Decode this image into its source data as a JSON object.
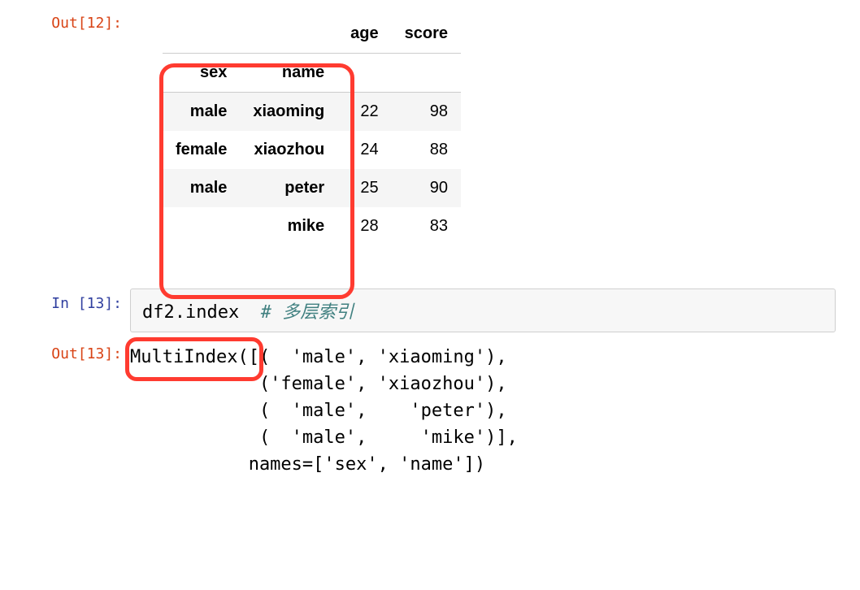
{
  "cells": {
    "out12": {
      "prompt": "Out[12]:",
      "columns": [
        "age",
        "score"
      ],
      "index_names": [
        "sex",
        "name"
      ],
      "rows": [
        {
          "sex": "male",
          "name": "xiaoming",
          "age": "22",
          "score": "98"
        },
        {
          "sex": "female",
          "name": "xiaozhou",
          "age": "24",
          "score": "88"
        },
        {
          "sex": "male",
          "name": "peter",
          "age": "25",
          "score": "90"
        },
        {
          "sex": "",
          "name": "mike",
          "age": "28",
          "score": "83"
        }
      ]
    },
    "in13": {
      "prompt": "In [13]:",
      "code": "df2.index",
      "comment": "# 多层索引"
    },
    "out13": {
      "prompt": "Out[13]:",
      "text": "MultiIndex([(  'male', 'xiaoming'),\n            ('female', 'xiaozhou'),\n            (  'male',    'peter'),\n            (  'male',     'mike')],\n           names=['sex', 'name'])"
    }
  }
}
